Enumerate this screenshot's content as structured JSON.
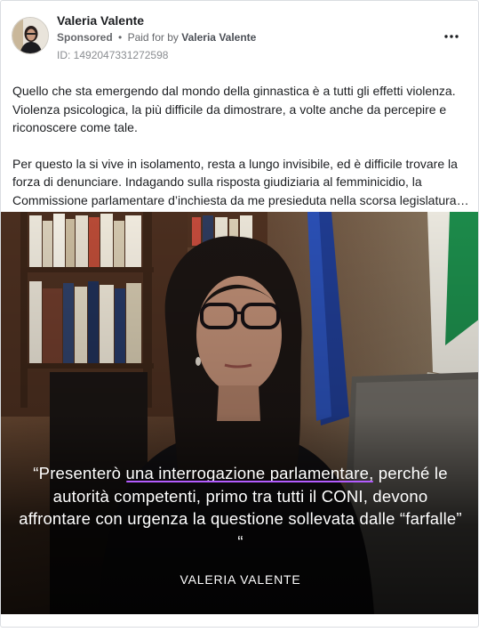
{
  "post": {
    "author_name": "Valeria Valente",
    "sponsored_label": "Sponsored",
    "separator": "•",
    "paid_for_prefix": "Paid for by",
    "paid_for_name": "Valeria Valente",
    "ad_id": "ID: 1492047331272598",
    "more_icon": "more-horizontal-icon",
    "paragraphs": [
      "Quello che sta emergendo dal mondo della ginnastica è a tutti gli effetti violenza. Violenza psicologica, la più difficile da dimostrare, a volte anche da percepire e riconoscere come tale.",
      "Per questo la si vive in isolamento, resta a lungo invisibile, ed è difficile trovare la forza di denunciare. Indagando sulla risposta giudiziaria al femminicidio, la Commissione parlamentare d’inchiesta da me presieduta nella scorsa legislatura…"
    ]
  },
  "media": {
    "quote_open": "“Presenterò ",
    "quote_highlight": "una interrogazione parlamentare,",
    "quote_rest": " perché le autorità competenti, primo tra tutti il CONI, devono affrontare con urgenza la questione sollevata dalle “farfalle” “",
    "quote_author": "VALERIA VALENTE",
    "highlight_color": "#b35cff"
  }
}
